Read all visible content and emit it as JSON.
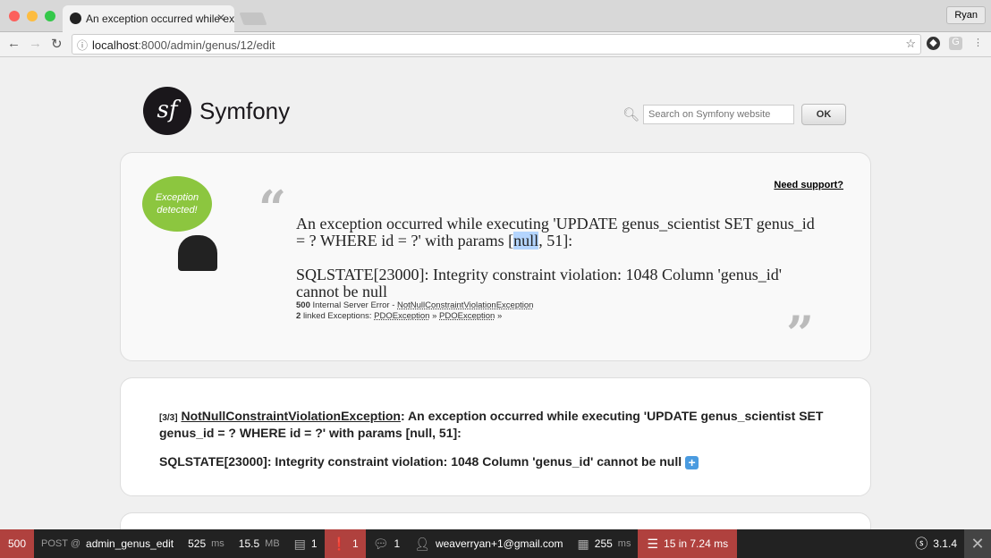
{
  "browser": {
    "tab_title": "An exception occurred while executing",
    "user": "Ryan",
    "url_host": "localhost",
    "url_path": ":8000/admin/genus/12/edit"
  },
  "header": {
    "brand": "Symfony",
    "search_placeholder": "Search on Symfony website",
    "ok_label": "OK"
  },
  "exception": {
    "bubble": "Exception detected!",
    "support_link": "Need support?",
    "message_before": "An exception occurred while executing 'UPDATE genus_scientist SET genus_id = ? WHERE id = ?' with params [",
    "message_selected": "null",
    "message_after": ", 51]:",
    "message_sql": "SQLSTATE[23000]: Integrity constraint violation: 1048 Column 'genus_id' cannot be null",
    "status_code": "500",
    "status_text": "Internal Server Error - ",
    "exception_class": "NotNullConstraintViolationException",
    "linked_count": "2",
    "linked_label": "linked Exceptions:",
    "linked": [
      "PDOException",
      "PDOException"
    ]
  },
  "trace": {
    "index": "[3/3]",
    "class": "NotNullConstraintViolationException",
    "message": ": An exception occurred while executing 'UPDATE genus_scientist SET genus_id = ? WHERE id = ?' with params [null, 51]:",
    "sql": "SQLSTATE[23000]: Integrity constraint violation: 1048 Column 'genus_id' cannot be null",
    "expand": "+"
  },
  "toolbar": {
    "status": "500",
    "method": "POST @",
    "route": "admin_genus_edit",
    "time": "525",
    "time_unit": "ms",
    "memory": "15.5",
    "memory_unit": "MB",
    "forms": "1",
    "exceptions": "1",
    "translations": "1",
    "user": "weaverryan+1@gmail.com",
    "render_time": "255",
    "render_unit": "ms",
    "db": "15 in 7.24 ms",
    "version": "3.1.4"
  },
  "colors": {
    "error_red": "#b0413e",
    "bubble_green": "#8cc63f"
  }
}
